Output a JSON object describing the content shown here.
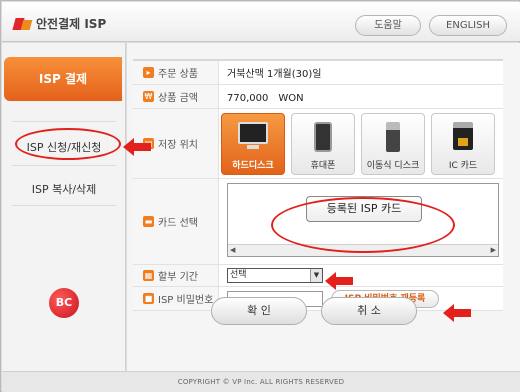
{
  "header": {
    "app_title": "안전결제 ISP",
    "help_label": "도움말",
    "english_label": "ENGLISH"
  },
  "nav": {
    "active_label": "ISP 결제",
    "items": [
      {
        "label": "ISP 신청/재신청"
      },
      {
        "label": "ISP 복사/삭제"
      }
    ],
    "bc_logo_text": "BC"
  },
  "form": {
    "order_product": {
      "label": "주문 상품",
      "value": "거북산맥 1개월(30)일"
    },
    "product_amount": {
      "label": "상품 금액",
      "value": "770,000　WON"
    },
    "storage": {
      "label": "저장 위치",
      "devices": [
        {
          "label": "하드디스크",
          "icon": "monitor-icon",
          "selected": true
        },
        {
          "label": "휴대폰",
          "icon": "phone-icon",
          "selected": false
        },
        {
          "label": "이동식 디스크",
          "icon": "usb-drive-icon",
          "selected": false
        },
        {
          "label": "IC 카드",
          "icon": "ic-card-icon",
          "selected": false
        }
      ]
    },
    "card_select": {
      "label": "카드 선택",
      "registered_card": "등록된 ISP 카드"
    },
    "installment": {
      "label": "할부 기간",
      "selected": "선택"
    },
    "isp_password": {
      "label": "ISP 비밀번호",
      "value": "",
      "reregister_label": "ISP 비밀번호 재등록"
    }
  },
  "actions": {
    "confirm_label": "확 인",
    "cancel_label": "취 소"
  },
  "footer": {
    "copyright": "COPYRIGHT © VP Inc. ALL RIGHTS RESERVED"
  },
  "colors": {
    "accent": "#e4611a",
    "annotation_red": "#e2211c"
  }
}
